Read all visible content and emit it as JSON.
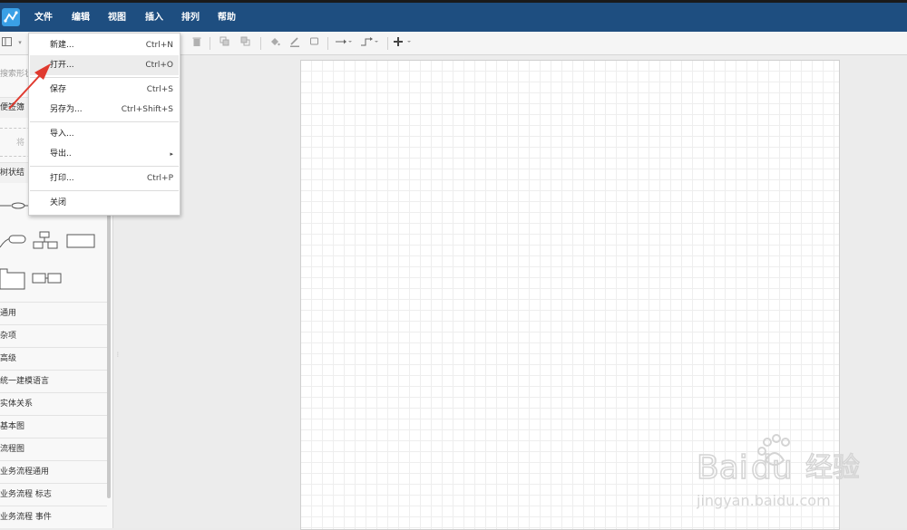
{
  "menubar": {
    "items": [
      "文件",
      "编辑",
      "视图",
      "插入",
      "排列",
      "帮助"
    ]
  },
  "sidebar": {
    "search_placeholder": "搜索形状",
    "sections": {
      "sticky": "便签簿",
      "drag_hint": "将",
      "tree": "树状结"
    },
    "categories": [
      "通用",
      "杂项",
      "高级",
      "统一建模语言",
      "实体关系",
      "基本图",
      "流程图",
      "业务流程通用",
      "业务流程 标志",
      "业务流程 事件"
    ]
  },
  "file_menu": {
    "new": {
      "label": "新建...",
      "shortcut": "Ctrl+N"
    },
    "open": {
      "label": "打开...",
      "shortcut": "Ctrl+O"
    },
    "save": {
      "label": "保存",
      "shortcut": "Ctrl+S"
    },
    "save_as": {
      "label": "另存为...",
      "shortcut": "Ctrl+Shift+S"
    },
    "import": {
      "label": "导入..."
    },
    "export": {
      "label": "导出.."
    },
    "print": {
      "label": "打印...",
      "shortcut": "Ctrl+P"
    },
    "close": {
      "label": "关闭"
    }
  },
  "watermark": {
    "brand": "Bai",
    "brand2": "du",
    "cn": "经验",
    "url": "jingyan.baidu.com"
  },
  "colors": {
    "menubar": "#1e4e80",
    "logo": "#3aa0e6",
    "arrow": "#e03a2f"
  }
}
